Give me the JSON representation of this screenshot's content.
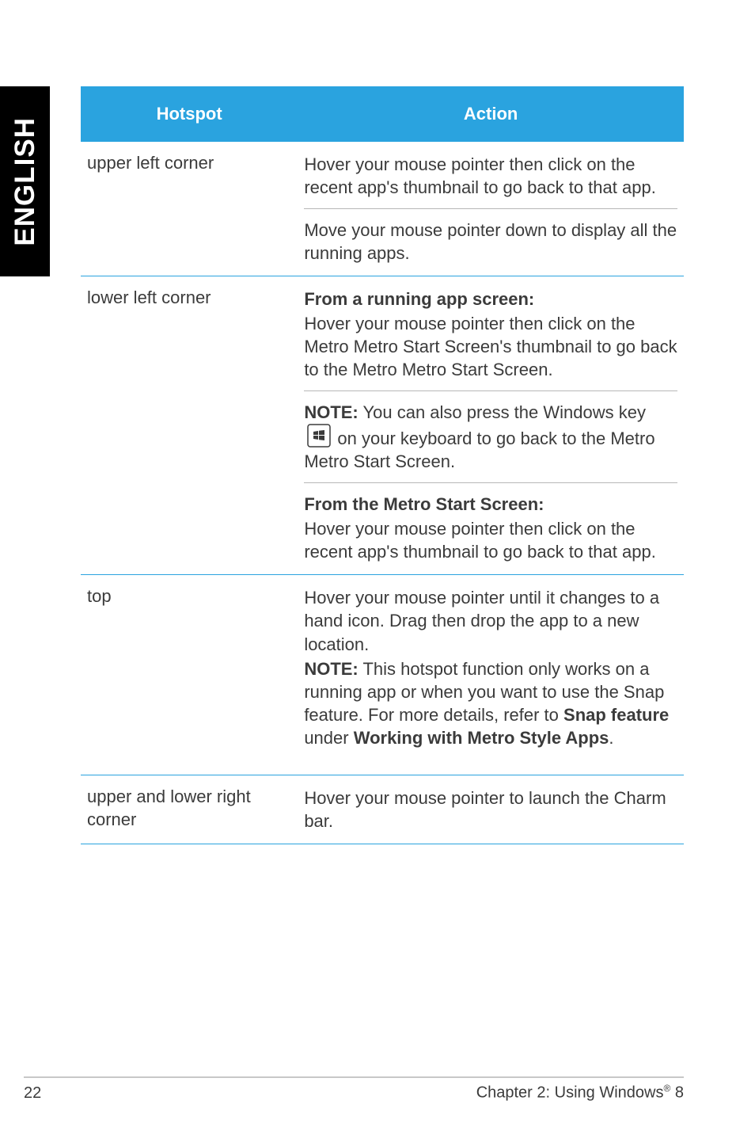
{
  "side_tab": {
    "label": "ENGLISH"
  },
  "table": {
    "headers": {
      "hotspot": "Hotspot",
      "action": "Action"
    },
    "rows": [
      {
        "hotspot": "upper left corner",
        "actions": [
          {
            "parts": [
              {
                "t": "Hover your mouse pointer then click on the recent app's thumbnail to go back to that app."
              }
            ]
          },
          {
            "divider": true
          },
          {
            "parts": [
              {
                "t": "Move your mouse pointer down to display all the running apps."
              }
            ]
          }
        ]
      },
      {
        "hotspot": "lower left corner",
        "actions": [
          {
            "parts": [
              {
                "t": "From a running app screen:",
                "b": true
              }
            ]
          },
          {
            "parts": [
              {
                "t": "Hover your mouse pointer then click on the Metro Metro Start Screen's thumbnail to go back to the Metro Metro Start Screen."
              }
            ]
          },
          {
            "divider": true
          },
          {
            "parts": [
              {
                "t": "NOTE:",
                "b": true
              },
              {
                "t": "  You can also press the Windows key "
              },
              {
                "icon": "windows-key"
              },
              {
                "t": " on your keyboard to go back to the Metro Metro Start Screen."
              }
            ]
          },
          {
            "divider": true
          },
          {
            "parts": [
              {
                "t": "From the Metro Start Screen:",
                "b": true
              }
            ]
          },
          {
            "parts": [
              {
                "t": "Hover your mouse pointer then click on the recent app's thumbnail to go back to that app."
              }
            ]
          }
        ]
      },
      {
        "hotspot": "top",
        "actions": [
          {
            "parts": [
              {
                "t": "Hover your mouse pointer until it changes to a hand icon. Drag then drop the app to a new location."
              }
            ]
          },
          {
            "parts": [
              {
                "t": "NOTE:",
                "b": true
              },
              {
                "t": "  This hotspot function only works on a running app or when you want to use the Snap feature. For more details, refer to "
              },
              {
                "t": "Snap feature",
                "b": true
              },
              {
                "t": " under "
              },
              {
                "t": "Working with Metro Style Apps",
                "b": true
              },
              {
                "t": "."
              }
            ]
          },
          {
            "spacer": true
          }
        ]
      },
      {
        "hotspot": "upper and lower right corner",
        "actions": [
          {
            "parts": [
              {
                "t": "Hover your mouse pointer to launch the Charm bar."
              }
            ]
          }
        ]
      }
    ]
  },
  "footer": {
    "page_number": "22",
    "chapter_prefix": "Chapter 2: Using Windows",
    "reg": "®",
    "chapter_suffix": " 8"
  }
}
